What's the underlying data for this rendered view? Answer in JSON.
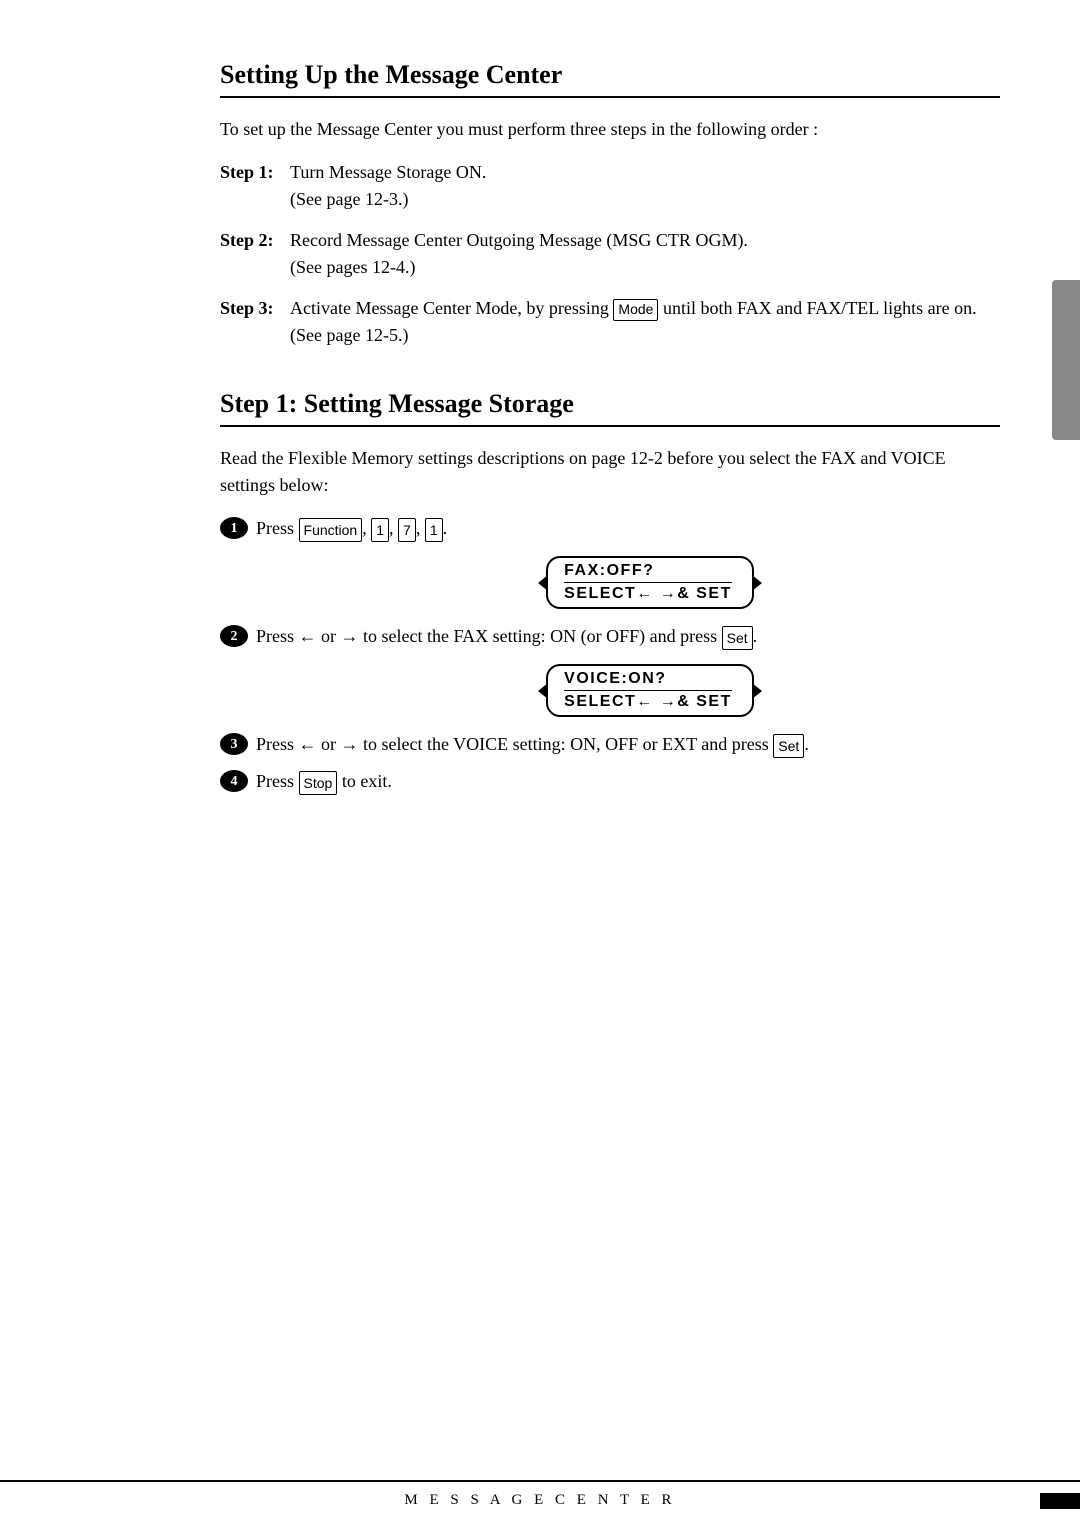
{
  "page": {
    "section1": {
      "title": "Setting Up the Message Center",
      "intro": "To set up the Message Center you must perform three steps in the following order :",
      "steps": [
        {
          "label": "Step 1:",
          "text": "Turn Message Storage ON.",
          "subtext": "(See page 12-3.)"
        },
        {
          "label": "Step 2:",
          "text": "Record Message Center Outgoing Message (MSG CTR OGM).",
          "subtext": "(See pages 12-4.)"
        },
        {
          "label": "Step 3:",
          "text": "Activate Message Center Mode, by pressing",
          "key": "Mode",
          "text2": "until both FAX and FAX/TEL lights are on.",
          "subtext": "(See page 12-5.)"
        }
      ]
    },
    "section2": {
      "title": "Step 1:  Setting Message Storage",
      "intro": "Read the Flexible Memory settings descriptions on page 12-2 before you select the FAX and VOICE settings below:",
      "steps": [
        {
          "num": "1",
          "text_before": "Press",
          "keys": [
            "Function",
            "1",
            "7",
            "1"
          ],
          "lcd1_line1": "FAX:OFF?",
          "lcd1_line2": "SELECT←  →& SET"
        },
        {
          "num": "2",
          "text": "Press ← or → to select the FAX setting:  ON (or OFF) and press",
          "key": "Set",
          "lcd2_line1": "VOICE:ON?",
          "lcd2_line2": "SELECT←  →& SET"
        },
        {
          "num": "3",
          "text": "Press ← or → to select the VOICE setting:  ON, OFF or EXT and press",
          "key": "Set"
        },
        {
          "num": "4",
          "text": "Press",
          "key": "Stop",
          "text2": "to exit."
        }
      ]
    },
    "footer": {
      "center": "M E S S A G E   C E N T E R",
      "right_label": ""
    }
  }
}
